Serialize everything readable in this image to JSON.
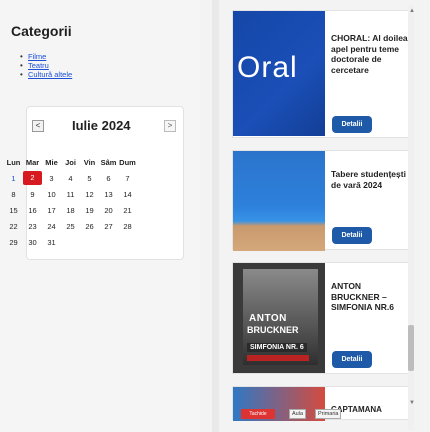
{
  "sidebar": {
    "title": "Categorii",
    "categories": [
      "Filme",
      "Teatru",
      "Cultură altele"
    ]
  },
  "calendar": {
    "prev": "<",
    "next": ">",
    "month_label": "Iulie 2024",
    "weekdays": [
      "Lun",
      "Mar",
      "Mie",
      "Joi",
      "Vin",
      "Sâm",
      "Dum"
    ],
    "weeks": [
      [
        "1",
        "2",
        "3",
        "4",
        "5",
        "6",
        "7"
      ],
      [
        "8",
        "9",
        "10",
        "11",
        "12",
        "13",
        "14"
      ],
      [
        "15",
        "16",
        "17",
        "18",
        "19",
        "20",
        "21"
      ],
      [
        "22",
        "23",
        "24",
        "25",
        "26",
        "27",
        "28"
      ],
      [
        "29",
        "30",
        "31",
        "",
        "",
        "",
        ""
      ]
    ],
    "today": "2"
  },
  "events": [
    {
      "title": "CHORAL: Al doilea apel pentru teme doctorale de cercetare",
      "image_text": "Oral",
      "button": "Detalii"
    },
    {
      "title": "Tabere studențești de vară 2024",
      "button": "Detalii"
    },
    {
      "title": "ANTON BRUCKNER – SIMFONIA NR.6",
      "image_lines": [
        "ANTON",
        "BRUCKNER",
        "SIMFONIA NR. 6"
      ],
      "button": "Detalii"
    },
    {
      "title": "CAPTAMANA",
      "tags": [
        "Tachide",
        "Aula",
        "Primaria"
      ]
    }
  ],
  "colors": {
    "accent": "#1e5aa8",
    "today": "#d71920",
    "link": "#1a4fd6"
  }
}
